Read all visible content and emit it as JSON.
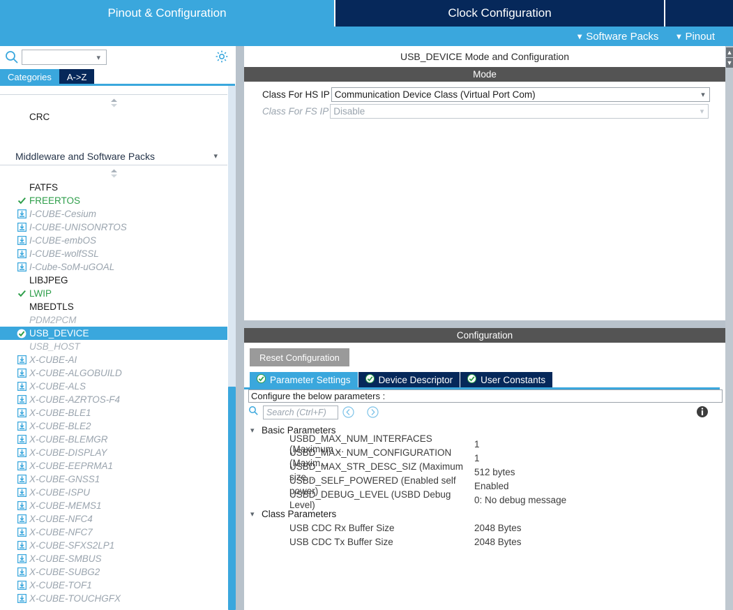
{
  "topbar": {
    "tabs": [
      {
        "label": "Pinout & Configuration",
        "state": "active"
      },
      {
        "label": "Clock Configuration",
        "state": "inactive"
      },
      {
        "label": "",
        "state": "inactive"
      }
    ]
  },
  "subbar": {
    "items": [
      {
        "label": "Software Packs",
        "icon": "chevron-down-icon"
      },
      {
        "label": "Pinout",
        "icon": "chevron-down-icon"
      }
    ]
  },
  "sidebar": {
    "search": {
      "value": "",
      "placeholder": ""
    },
    "gear_icon": "gear-icon",
    "tabs": [
      {
        "label": "Categories",
        "selected": true
      },
      {
        "label": "A->Z",
        "selected": false
      }
    ],
    "categories": [
      {
        "name": "",
        "clipped": true,
        "items": [
          {
            "label": "CRC",
            "state": "plain"
          }
        ]
      },
      {
        "name": "Middleware and Software Packs",
        "clipped": false,
        "items": [
          {
            "label": "FATFS",
            "state": "plain"
          },
          {
            "label": "FREERTOS",
            "state": "enabled"
          },
          {
            "label": "I-CUBE-Cesium",
            "state": "download"
          },
          {
            "label": "I-CUBE-UNISONRTOS",
            "state": "download"
          },
          {
            "label": "I-CUBE-embOS",
            "state": "download"
          },
          {
            "label": "I-CUBE-wolfSSL",
            "state": "download"
          },
          {
            "label": "I-Cube-SoM-uGOAL",
            "state": "download"
          },
          {
            "label": "LIBJPEG",
            "state": "plain"
          },
          {
            "label": "LWIP",
            "state": "enabled"
          },
          {
            "label": "MBEDTLS",
            "state": "plain"
          },
          {
            "label": "PDM2PCM",
            "state": "greyitalic"
          },
          {
            "label": "USB_DEVICE",
            "state": "selected"
          },
          {
            "label": "USB_HOST",
            "state": "greyitalic"
          },
          {
            "label": "X-CUBE-AI",
            "state": "download"
          },
          {
            "label": "X-CUBE-ALGOBUILD",
            "state": "download"
          },
          {
            "label": "X-CUBE-ALS",
            "state": "download"
          },
          {
            "label": "X-CUBE-AZRTOS-F4",
            "state": "download"
          },
          {
            "label": "X-CUBE-BLE1",
            "state": "download"
          },
          {
            "label": "X-CUBE-BLE2",
            "state": "download"
          },
          {
            "label": "X-CUBE-BLEMGR",
            "state": "download"
          },
          {
            "label": "X-CUBE-DISPLAY",
            "state": "download"
          },
          {
            "label": "X-CUBE-EEPRMA1",
            "state": "download"
          },
          {
            "label": "X-CUBE-GNSS1",
            "state": "download"
          },
          {
            "label": "X-CUBE-ISPU",
            "state": "download"
          },
          {
            "label": "X-CUBE-MEMS1",
            "state": "download"
          },
          {
            "label": "X-CUBE-NFC4",
            "state": "download"
          },
          {
            "label": "X-CUBE-NFC7",
            "state": "download"
          },
          {
            "label": "X-CUBE-SFXS2LP1",
            "state": "download"
          },
          {
            "label": "X-CUBE-SMBUS",
            "state": "download"
          },
          {
            "label": "X-CUBE-SUBG2",
            "state": "download"
          },
          {
            "label": "X-CUBE-TOF1",
            "state": "download"
          },
          {
            "label": "X-CUBE-TOUCHGFX",
            "state": "download"
          }
        ]
      }
    ]
  },
  "main": {
    "title": "USB_DEVICE Mode and Configuration",
    "mode": {
      "header": "Mode",
      "rows": [
        {
          "label": "Class For HS IP",
          "value": "Communication Device Class (Virtual Port Com)",
          "disabled": false
        },
        {
          "label": "Class For FS IP",
          "value": "Disable",
          "disabled": true
        }
      ]
    },
    "configuration": {
      "header": "Configuration",
      "reset_label": "Reset Configuration",
      "tabs": [
        {
          "label": "Parameter Settings",
          "selected": true,
          "icon": "check-circle-icon"
        },
        {
          "label": "Device Descriptor",
          "selected": false,
          "icon": "check-circle-icon"
        },
        {
          "label": "User Constants",
          "selected": false,
          "icon": "check-circle-icon"
        }
      ],
      "description": "Configure the below parameters :",
      "search": {
        "value": "",
        "placeholder": "Search (Ctrl+F)"
      },
      "nav_prev_icon": "prev-circle-icon",
      "nav_next_icon": "next-circle-icon",
      "info_icon": "info-icon",
      "groups": [
        {
          "name": "Basic Parameters",
          "expanded": true,
          "params": [
            {
              "name": "USBD_MAX_NUM_INTERFACES (Maximum ...",
              "value": "1"
            },
            {
              "name": "USBD_MAX_NUM_CONFIGURATION (Maxim...",
              "value": "1"
            },
            {
              "name": "USBD_MAX_STR_DESC_SIZ (Maximum size...",
              "value": "512 bytes"
            },
            {
              "name": "USBD_SELF_POWERED (Enabled self power)",
              "value": "Enabled"
            },
            {
              "name": "USBD_DEBUG_LEVEL (USBD Debug Level)",
              "value": "0: No debug message"
            }
          ]
        },
        {
          "name": "Class Parameters",
          "expanded": true,
          "params": [
            {
              "name": "USB CDC Rx Buffer Size",
              "value": "2048 Bytes"
            },
            {
              "name": "USB CDC Tx Buffer Size",
              "value": "2048 Bytes"
            }
          ]
        }
      ]
    }
  },
  "colors": {
    "accent_blue": "#3aa7dd",
    "navy": "#06285a",
    "header_gray": "#545454",
    "divider_gray": "#b8c2cb",
    "enabled_green": "#2e9e4a"
  }
}
